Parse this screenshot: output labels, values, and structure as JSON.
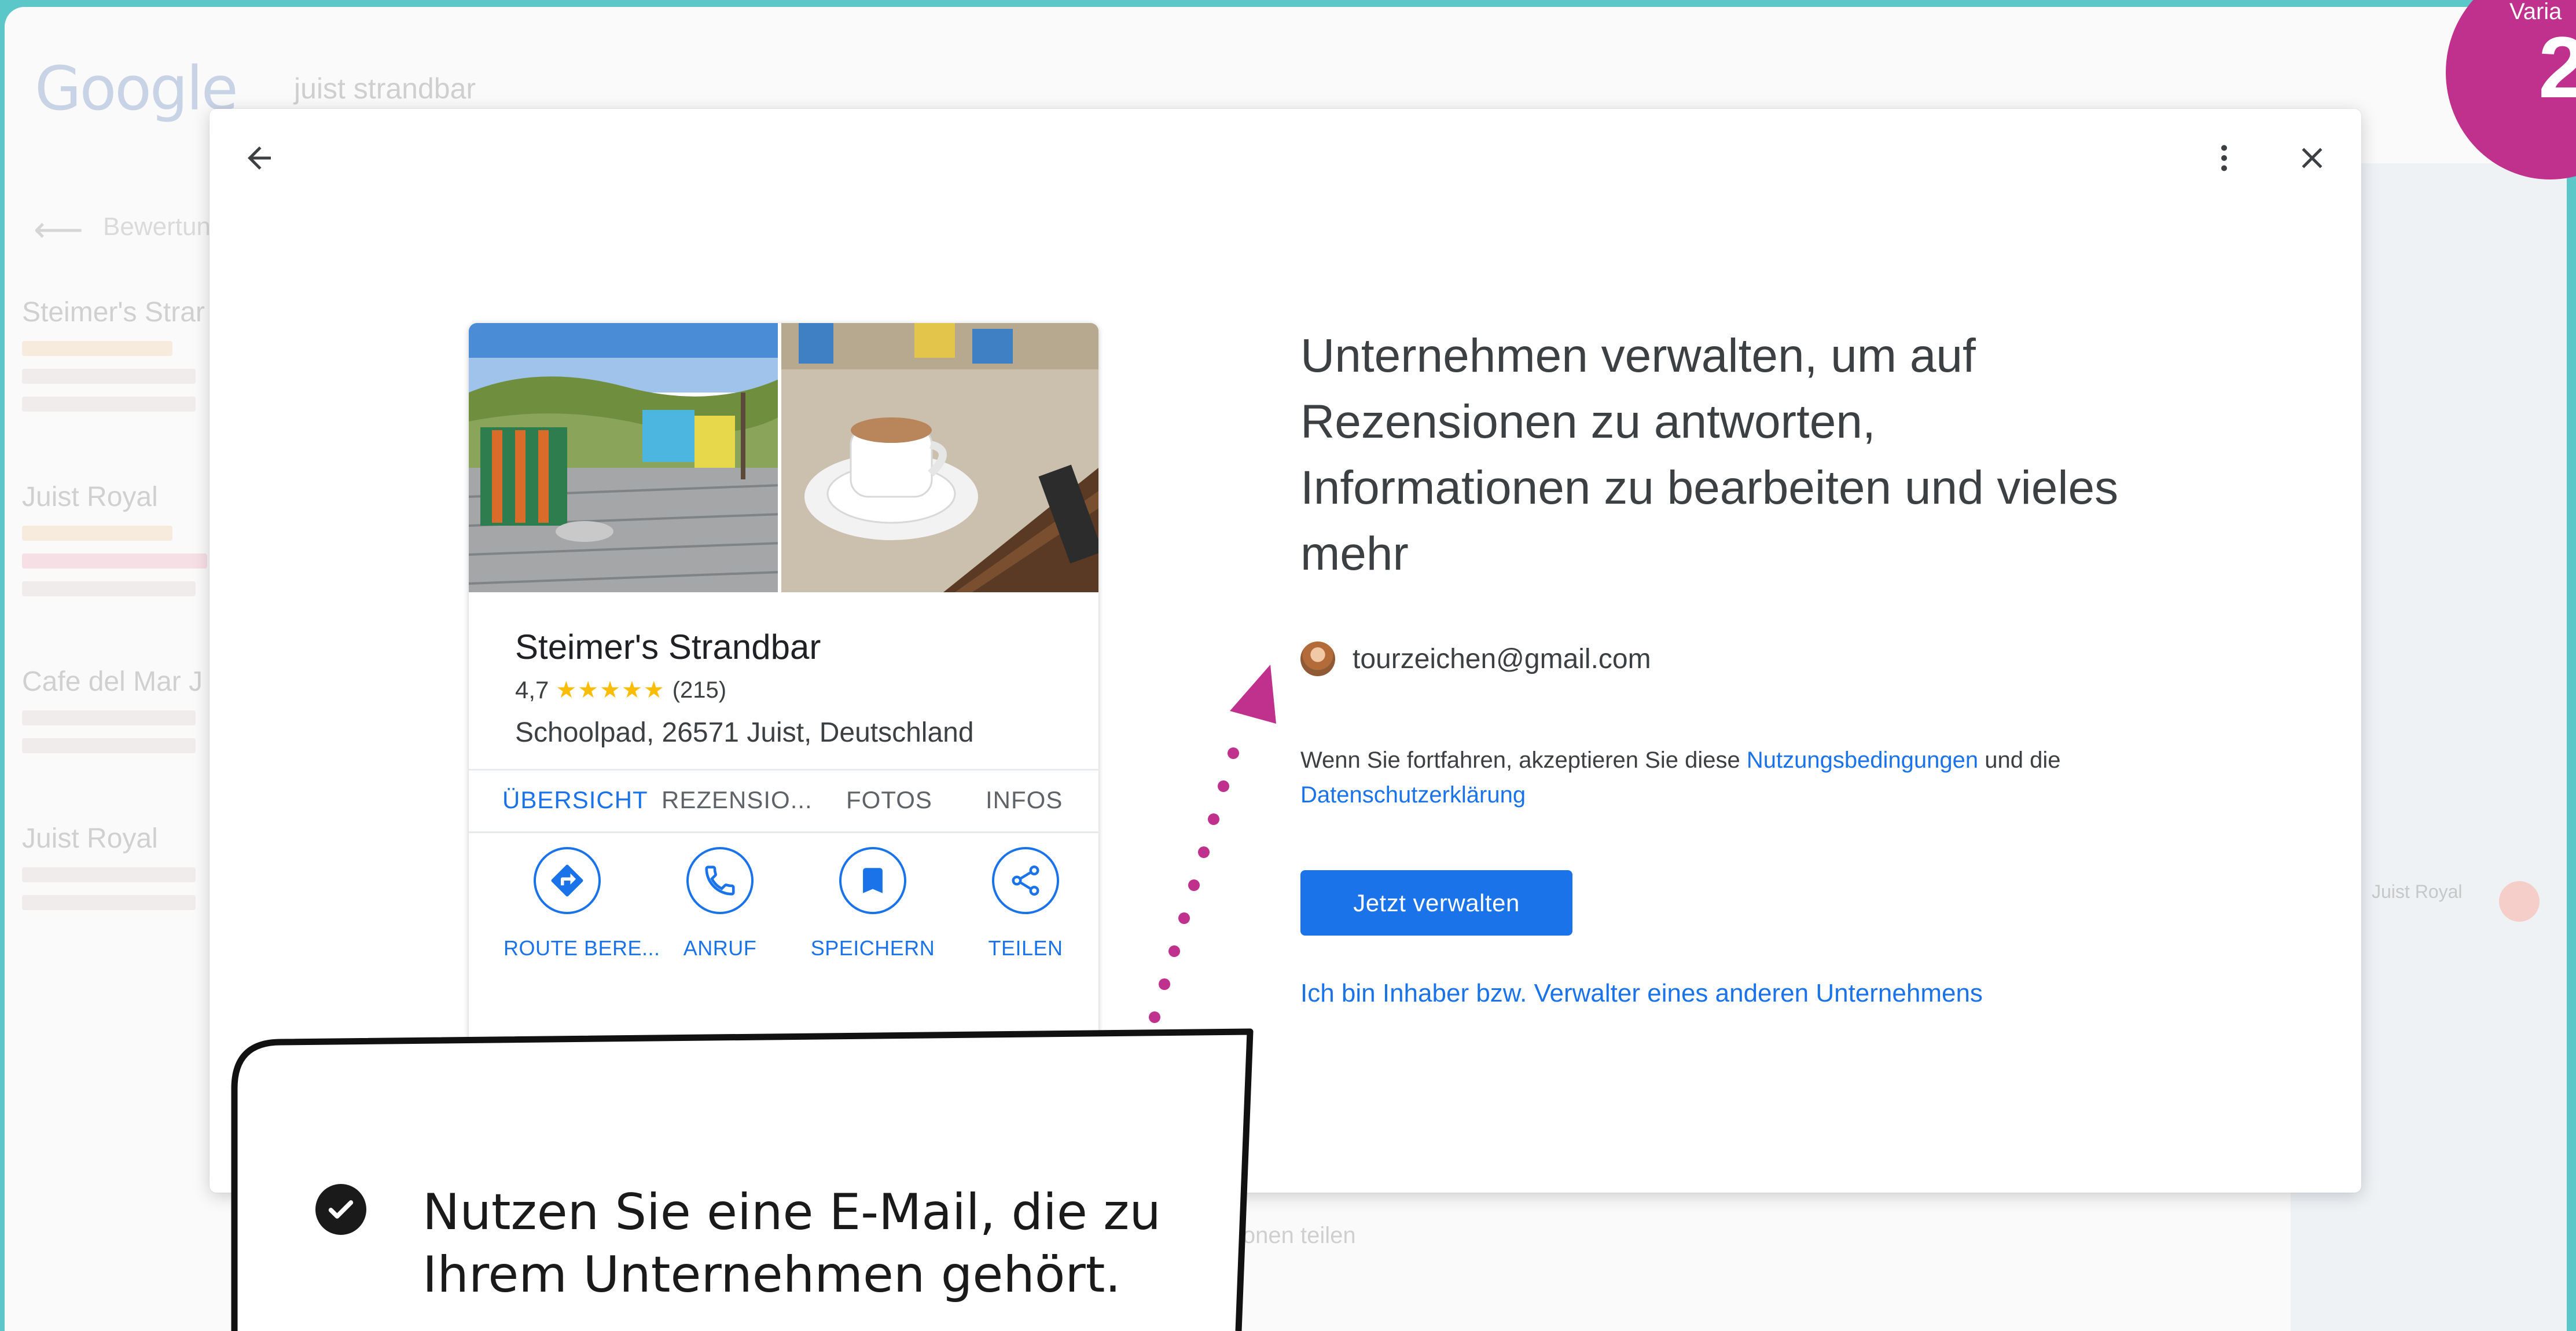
{
  "background": {
    "search_query": "juist strandbar",
    "sidebar_tab": "Bewertun",
    "results": [
      "Steimer's Strar",
      "Juist Royal",
      "Cafe del Mar J",
      "Juist Royal"
    ],
    "map_label": "Juist Royal",
    "share_text": "ionen teilen"
  },
  "modal": {
    "card": {
      "title": "Steimer's Strandbar",
      "rating": "4,7",
      "stars": "★★★★★",
      "review_count": "(215)",
      "address": "Schoolpad, 26571 Juist, Deutschland",
      "tabs": [
        "ÜBERSICHT",
        "REZENSIO...",
        "FOTOS",
        "INFOS"
      ],
      "actions": [
        "ROUTE BERE...",
        "ANRUF",
        "SPEICHERN",
        "TEILEN"
      ]
    },
    "headline": "Unternehmen verwalten, um auf Rezensionen zu antworten, Informationen zu bearbeiten und vieles mehr",
    "email": "tourzeichen@gmail.com",
    "terms": {
      "prefix": "Wenn Sie fortfahren, akzeptieren Sie diese ",
      "terms_link": "Nutzungsbedingungen",
      "middle": " und die ",
      "privacy_link": "Datenschutzerklärung"
    },
    "primary_button": "Jetzt verwalten",
    "other_business_link": "Ich bin Inhaber bzw. Verwalter eines anderen Unternehmens"
  },
  "annotation": {
    "callout": "Nutzen Sie eine E-Mail, die zu Ihrem Unternehmen gehört.",
    "badge_label": "Varia",
    "badge_number": "2",
    "accent_color": "#c0308d"
  }
}
